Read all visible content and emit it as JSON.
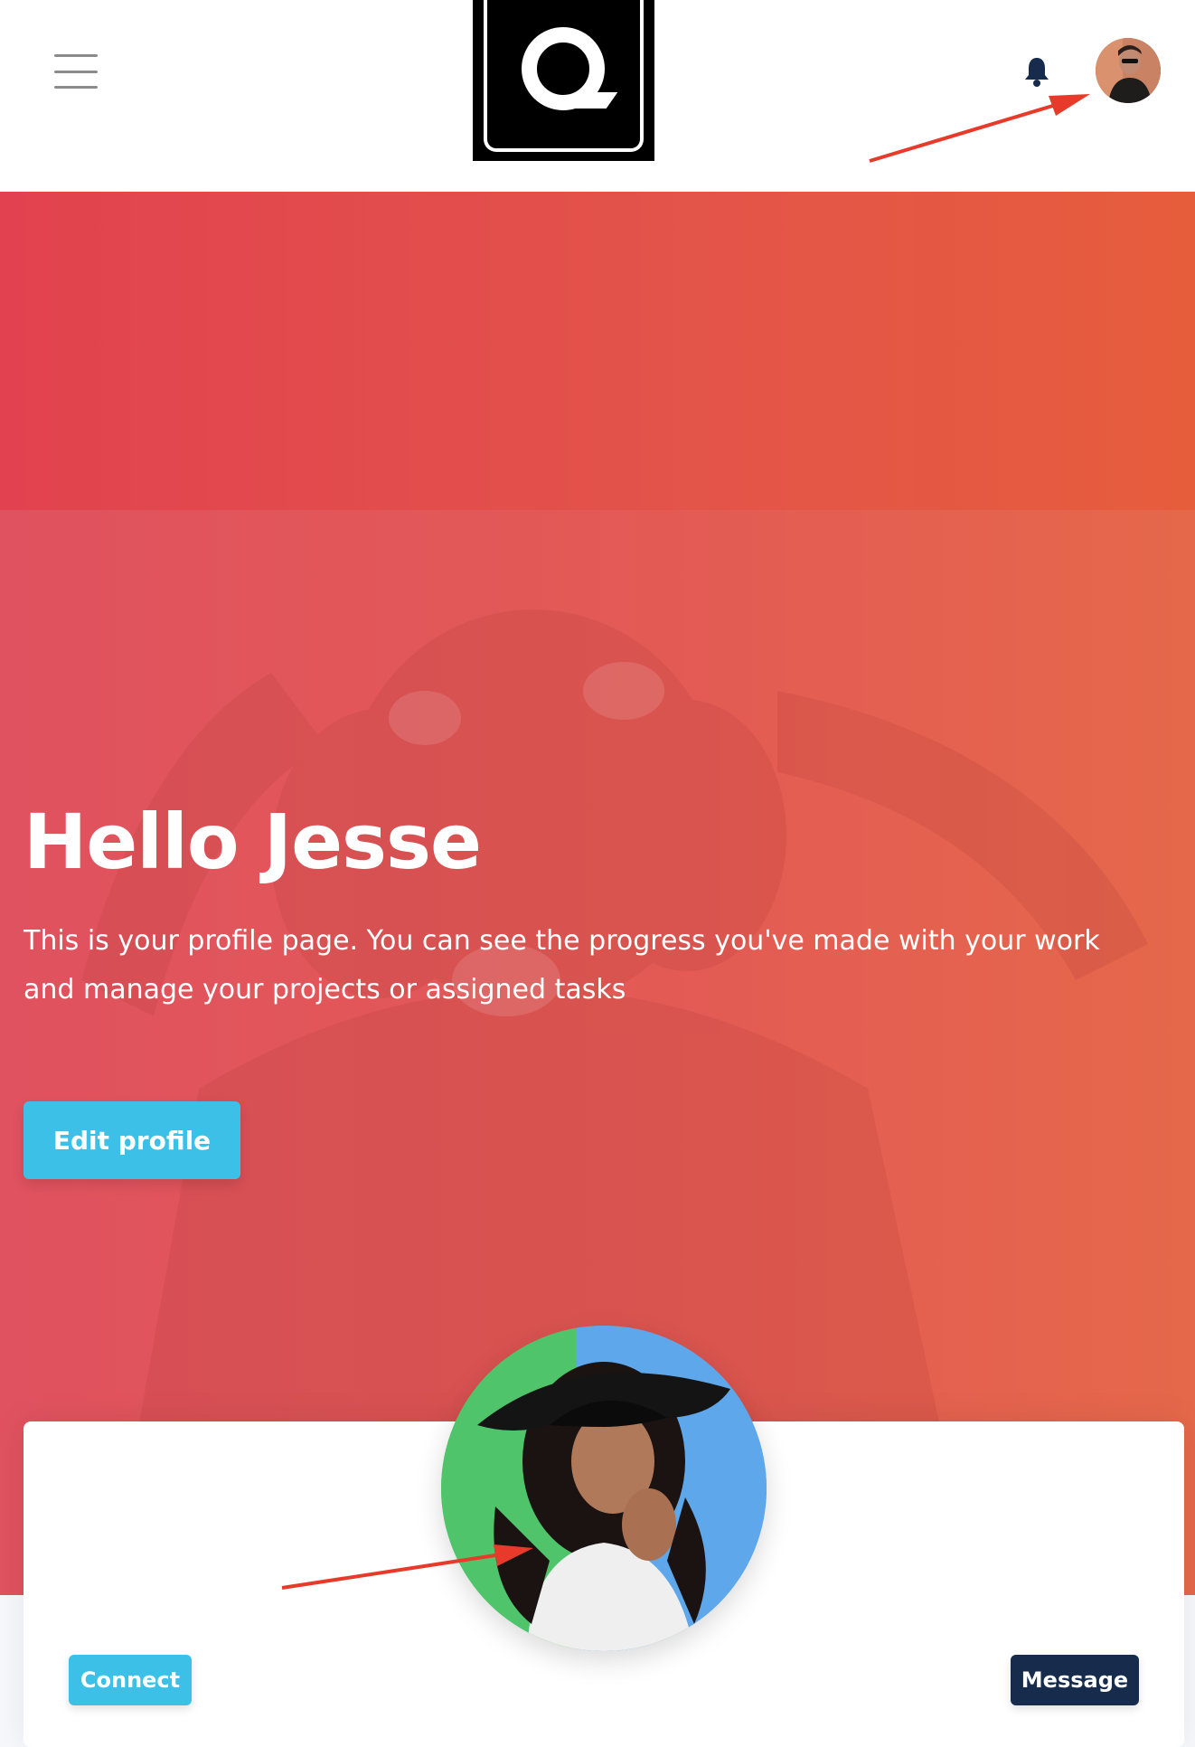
{
  "navbar": {
    "menu_icon": "hamburger-menu-icon",
    "logo_icon": "q-logo",
    "notification_icon": "bell-icon",
    "user_avatar": "user-avatar"
  },
  "hero": {
    "title": "Hello Jesse",
    "description": "This is your profile page. You can see the progress you've made with your work and manage your projects or assigned tasks",
    "edit_button": "Edit profile"
  },
  "profile_card": {
    "connect_button": "Connect",
    "message_button": "Message"
  },
  "colors": {
    "gradient_start": "#e2424f",
    "gradient_end": "#e65d3c",
    "info_button": "#3cc0e8",
    "dark_button": "#172b4d",
    "annotation_arrow": "#e83a2a"
  }
}
